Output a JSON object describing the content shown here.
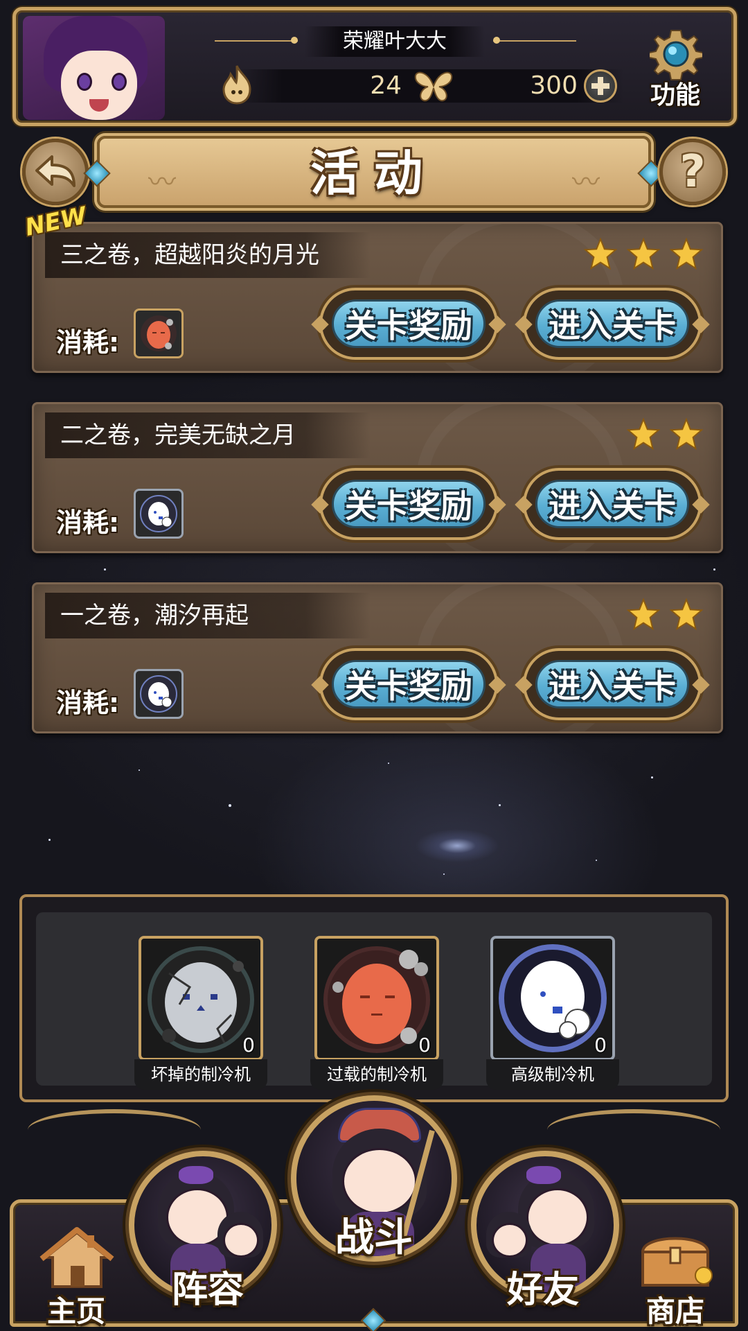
{
  "header": {
    "player_name": "荣耀叶大大",
    "stamina_value": "24",
    "currency_value": "300",
    "function_label": "功能"
  },
  "title_bar": {
    "title": "活动"
  },
  "new_badge": "NEW",
  "stages": [
    {
      "name": "三之卷，超越阳炎的月光",
      "stars": 3,
      "cost_label": "消耗:",
      "cost_item": "overloaded-cooler-icon",
      "reward_label": "关卡奖励",
      "enter_label": "进入关卡"
    },
    {
      "name": "二之卷，完美无缺之月",
      "stars": 2,
      "cost_label": "消耗:",
      "cost_item": "advanced-cooler-icon",
      "reward_label": "关卡奖励",
      "enter_label": "进入关卡"
    },
    {
      "name": "一之卷，潮汐再起",
      "stars": 2,
      "cost_label": "消耗:",
      "cost_item": "advanced-cooler-icon",
      "reward_label": "关卡奖励",
      "enter_label": "进入关卡"
    }
  ],
  "inventory": [
    {
      "name": "坏掉的制冷机",
      "count": "0",
      "icon": "broken-cooler-icon"
    },
    {
      "name": "过载的制冷机",
      "count": "0",
      "icon": "overloaded-cooler-icon"
    },
    {
      "name": "高级制冷机",
      "count": "0",
      "icon": "advanced-cooler-icon"
    }
  ],
  "bottom_nav": {
    "home": "主页",
    "lineup": "阵容",
    "battle": "战斗",
    "friends": "好友",
    "shop": "商店"
  },
  "colors": {
    "gold_frame": "#c8a262",
    "card_brown": "#5b4838",
    "button_blue": "#5aaed3",
    "star_gold": "#f5c542",
    "background": "#16161d"
  }
}
